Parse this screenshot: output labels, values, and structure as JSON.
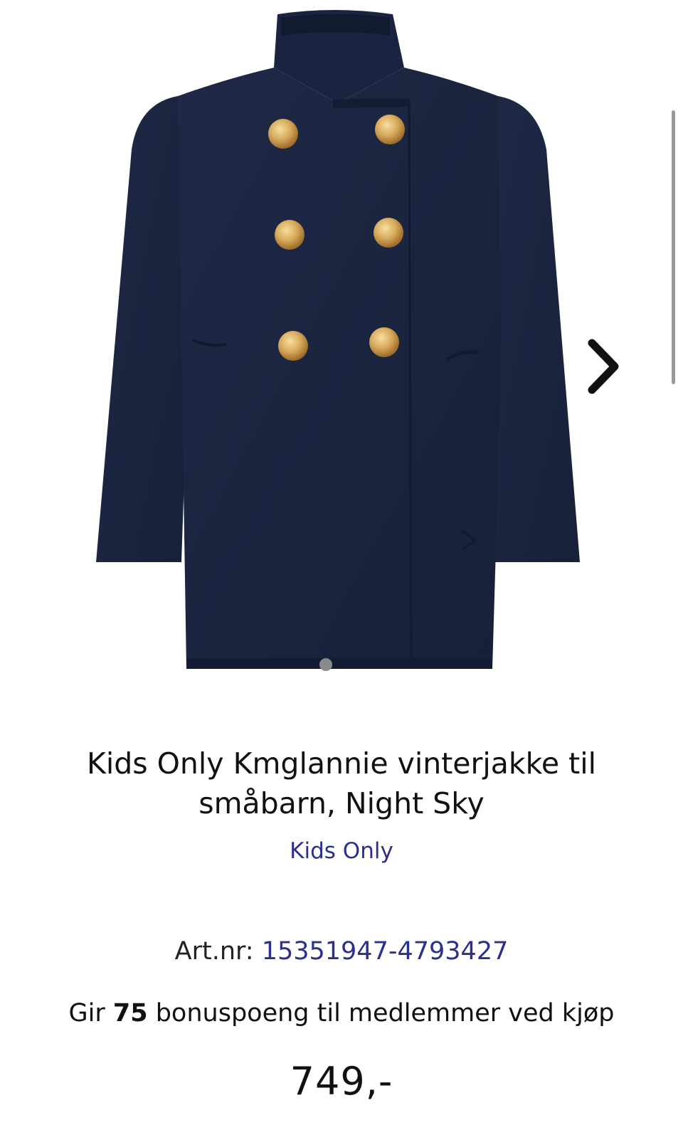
{
  "product": {
    "title": "Kids Only Kmglannie vinterjakke til småbarn, Night Sky",
    "brand": "Kids Only",
    "art_nr_label": "Art.nr: ",
    "art_nr_value": "15351947-4793427",
    "bonus_prefix": "Gir ",
    "bonus_points": "75",
    "bonus_suffix": " bonuspoeng til medlemmer ved kjøp",
    "price": "749,-"
  },
  "gallery": {
    "next_icon": "chevron-right-icon",
    "active_image": 1
  },
  "colors": {
    "link": "#2b2f8f",
    "coat": "#1c2541",
    "buttons_gold": "#c99a4a",
    "dot": "#8a8a8a",
    "scrollbar": "#9a9a9a"
  }
}
